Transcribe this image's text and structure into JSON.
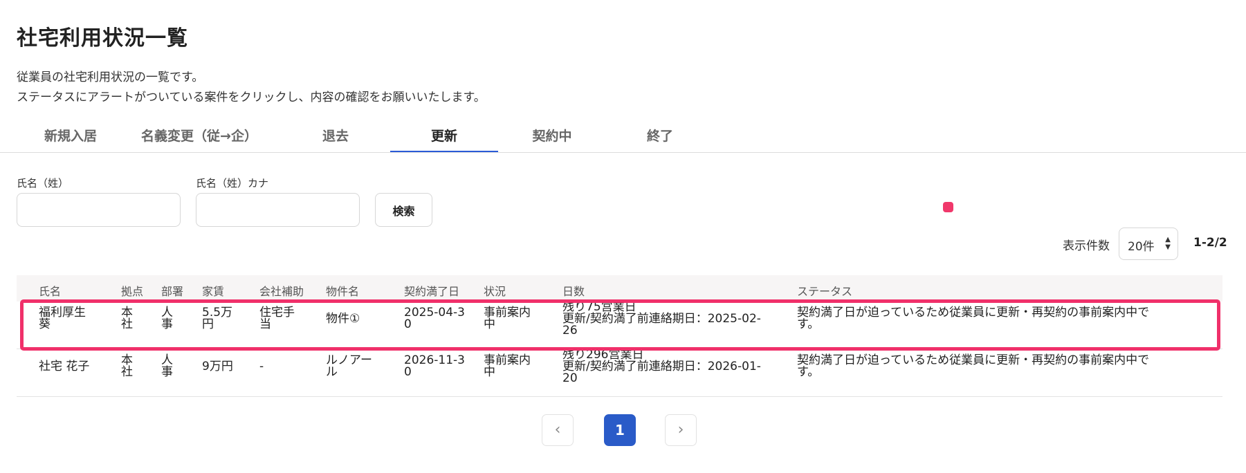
{
  "page": {
    "title": "社宅利用状況一覧",
    "description_line1": "従業員の社宅利用状況の一覧です。",
    "description_line2": "ステータスにアラートがついている案件をクリックし、内容の確認をお願いいたします。"
  },
  "tabs": [
    {
      "label": "新規入居"
    },
    {
      "label": "名義変更（従→企）"
    },
    {
      "label": "退去"
    },
    {
      "label": "更新",
      "active": true
    },
    {
      "label": "契約中"
    },
    {
      "label": "終了"
    }
  ],
  "search": {
    "last_name_label": "氏名（姓）",
    "last_name_value": "",
    "kana_label": "氏名（姓）カナ",
    "kana_value": "",
    "button_label": "検索"
  },
  "pagination_top": {
    "per_page_label": "表示件数",
    "per_page_value": "20件",
    "range": "1-2/2"
  },
  "table": {
    "headers": [
      "氏名",
      "拠点",
      "部署",
      "家賃",
      "会社補助",
      "物件名",
      "契約満了日",
      "状況",
      "日数",
      "ステータス"
    ],
    "rows": [
      {
        "name": [
          "福利厚生",
          "葵"
        ],
        "base": [
          "本",
          "社"
        ],
        "dept": [
          "人",
          "事"
        ],
        "rent": [
          "5.5万",
          "円"
        ],
        "subsidy": [
          "住宅手",
          "当"
        ],
        "property": [
          "物件①"
        ],
        "expiry": [
          "2025-04-3",
          "0"
        ],
        "state": [
          "事前案内",
          "中"
        ],
        "days": [
          "残り75営業日",
          "更新/契約満了前連絡期日：2025-02-",
          "26"
        ],
        "status": [
          "契約満了日が迫っているため従業員に更新・再契約の事前案内中で",
          "す。"
        ]
      },
      {
        "name": [
          "社宅 花子"
        ],
        "base": [
          "本",
          "社"
        ],
        "dept": [
          "人",
          "事"
        ],
        "rent": [
          "9万円"
        ],
        "subsidy": [
          "-"
        ],
        "property": [
          "ルノアー",
          "ル"
        ],
        "expiry": [
          "2026-11-3",
          "0"
        ],
        "state": [
          "事前案内",
          "中"
        ],
        "days": [
          "残り296営業日",
          "更新/契約満了前連絡期日：2026-01-",
          "20"
        ],
        "status": [
          "契約満了日が迫っているため従業員に更新・再契約の事前案内中で",
          "す。"
        ]
      }
    ]
  },
  "pagination_bottom": {
    "prev": "‹",
    "current": "1",
    "next": "›"
  },
  "colors": {
    "accent": "#2a5bc8",
    "highlight": "#f0306a",
    "alert_dot": "#f0386b"
  }
}
